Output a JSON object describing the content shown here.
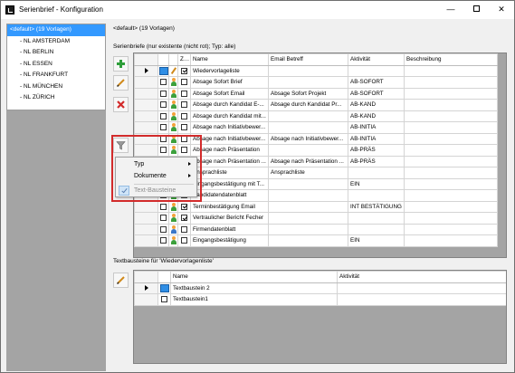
{
  "window": {
    "title": "Serienbrief - Konfiguration",
    "minimize": "—",
    "close": "✕"
  },
  "sidebar": {
    "items": [
      {
        "label": "<default> (19 Vorlagen)",
        "selected": true
      },
      {
        "label": "- NL AMSTERDAM"
      },
      {
        "label": "- NL BERLIN"
      },
      {
        "label": "- NL ESSEN"
      },
      {
        "label": "- NL FRANKFURT"
      },
      {
        "label": "- NL MÜNCHEN"
      },
      {
        "label": "- NL ZÜRICH"
      }
    ]
  },
  "main": {
    "header": "<default> (19 Vorlagen)",
    "serienbriefe_title": "Serienbriefe (nur existente (nicht rot); Typ: alle)",
    "textbausteine_title": "Textbausteine für 'Wiedervorlagenliste'"
  },
  "toolbar": {
    "add": "add-icon",
    "edit": "edit-icon",
    "delete": "delete-icon",
    "filter": "filter-icon",
    "edit2": "edit-icon"
  },
  "grid1": {
    "columns": [
      "Zus.",
      "Name",
      "Email Betreff",
      "Aktivität",
      "Beschreibung"
    ],
    "rows": [
      {
        "current": true,
        "sel": true,
        "zus": true,
        "icon": "pencil",
        "name": "Wiedervorlageliste",
        "email": "",
        "akt": ""
      },
      {
        "icon": "person",
        "name": "Absage Sofort Brief",
        "email": "",
        "akt": "AB-SOFORT"
      },
      {
        "icon": "person",
        "name": "Absage Sofort Email",
        "email": "Absage Sofort Projekt",
        "akt": "AB-SOFORT"
      },
      {
        "icon": "person",
        "name": "Absage durch Kandidat E-...",
        "email": "Absage durch Kandidat Pr...",
        "akt": "AB-KAND"
      },
      {
        "icon": "person",
        "name": "Absage durch Kandidat mit...",
        "email": "",
        "akt": "AB-KAND"
      },
      {
        "icon": "person",
        "name": "Absage nach Initiativbewer...",
        "email": "",
        "akt": "AB-INITIA"
      },
      {
        "icon": "person",
        "name": "Absage nach Initiativbewer...",
        "email": "Absage nach Initiativbewer...",
        "akt": "AB-INITIA"
      },
      {
        "icon": "person",
        "name": "Absage nach Präsentation",
        "email": "",
        "akt": "AB-PRÄS"
      },
      {
        "icon": "person",
        "name": "Absage nach Präsentation ...",
        "email": "Absage nach Präsentation ...",
        "akt": "AB-PRÄS"
      },
      {
        "icon": "person",
        "name": "Ansprachliste",
        "email": "Ansprachliste",
        "akt": ""
      },
      {
        "icon": "person",
        "name": "Eingangsbestätigung mit T...",
        "email": "",
        "akt": "EIN"
      },
      {
        "icon": "person",
        "name": "Kandidatendatenblatt",
        "email": "",
        "akt": ""
      },
      {
        "zus": true,
        "icon": "person",
        "name": "Terminbestätigung Email",
        "email": "",
        "akt": "INT BESTÄTIGUNG"
      },
      {
        "zus": true,
        "icon": "person",
        "name": "Vertraulicher Bericht Fecher",
        "email": "",
        "akt": ""
      },
      {
        "icon": "person-blue",
        "name": "Firmendatenblatt",
        "email": "",
        "akt": ""
      },
      {
        "icon": "person",
        "name": "Eingangsbestätigung",
        "email": "",
        "akt": "EIN"
      }
    ]
  },
  "grid2": {
    "columns": [
      "Name",
      "Aktivität"
    ],
    "rows": [
      {
        "current": true,
        "sel": true,
        "name": "Textbaustein 2",
        "akt": ""
      },
      {
        "name": "Textbaustein1",
        "akt": ""
      }
    ]
  },
  "context_menu": {
    "items": [
      {
        "label": "Typ",
        "submenu": true
      },
      {
        "label": "Dokumente",
        "submenu": true
      },
      {
        "label": "Text-Bausteine",
        "checked": true,
        "disabled": true
      }
    ]
  },
  "colors": {
    "selection": "#3399ff",
    "highlight_box": "#d22b2b"
  }
}
